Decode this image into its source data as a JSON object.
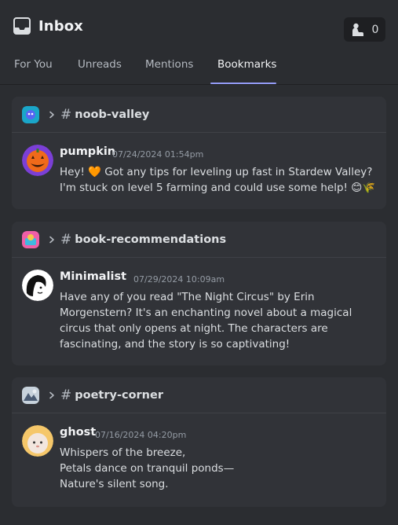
{
  "header": {
    "title": "Inbox",
    "status_count": "0"
  },
  "tabs": [
    {
      "label": "For You",
      "active": false
    },
    {
      "label": "Unreads",
      "active": false
    },
    {
      "label": "Mentions",
      "active": false
    },
    {
      "label": "Bookmarks",
      "active": true
    }
  ],
  "bookmarks": [
    {
      "channel": "noob-valley",
      "hash": "#",
      "author": "pumpkin",
      "timestamp": "07/24/2024 01:54pm",
      "lines": [
        "Hey! 🧡 Got any tips for leveling up fast in Stardew Valley?",
        "I'm stuck on level 5 farming and could use some help! 😊🌾"
      ]
    },
    {
      "channel": "book-recommendations",
      "hash": "#",
      "author": "Minimalist",
      "timestamp": "07/29/2024 10:09am",
      "lines": [
        "Have any of you read \"The Night Circus\" by Erin",
        "Morgenstern? It's an enchanting novel about a magical",
        "circus that only opens at night. The characters are",
        "fascinating, and the story is so captivating!"
      ]
    },
    {
      "channel": "poetry-corner",
      "hash": "#",
      "author": "ghost",
      "timestamp": "07/16/2024 04:20pm",
      "lines": [
        "Whispers of the breeze,",
        "Petals dance on tranquil ponds—",
        "Nature's silent song."
      ]
    }
  ],
  "icons": {
    "inbox": "inbox-icon",
    "status": "user-status-icon",
    "chevron": "chevron-right-icon"
  },
  "colors": {
    "background": "#2b2d31",
    "card": "#313338",
    "accent": "#949cf7"
  }
}
